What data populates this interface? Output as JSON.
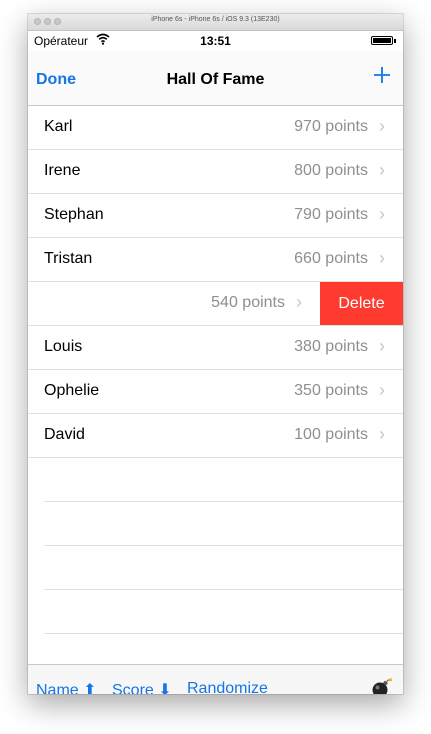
{
  "simulator": {
    "title": "iPhone 6s - iPhone 6s / iOS 9.3 (13E230)"
  },
  "status_bar": {
    "carrier": "Opérateur",
    "time": "13:51"
  },
  "nav": {
    "done_label": "Done",
    "title": "Hall Of Fame",
    "add_label": "+"
  },
  "rows": [
    {
      "name": "Karl",
      "points": "970 points"
    },
    {
      "name": "Irene",
      "points": "800 points"
    },
    {
      "name": "Stephan",
      "points": "790 points"
    },
    {
      "name": "Tristan",
      "points": "660 points"
    },
    {
      "name": "",
      "points": "540 points",
      "swiped": true,
      "delete_label": "Delete"
    },
    {
      "name": "Louis",
      "points": "380 points"
    },
    {
      "name": "Ophelie",
      "points": "350 points"
    },
    {
      "name": "David",
      "points": "100 points"
    }
  ],
  "chevron": "›",
  "toolbar": {
    "name_sort": "Name ⬆",
    "score_sort": "Score ⬇",
    "randomize": "Randomize",
    "bomb_icon": "bomb-icon"
  },
  "colors": {
    "accent": "#1476e6",
    "delete": "#ff3b30",
    "secondary_text": "#8e8e93"
  }
}
